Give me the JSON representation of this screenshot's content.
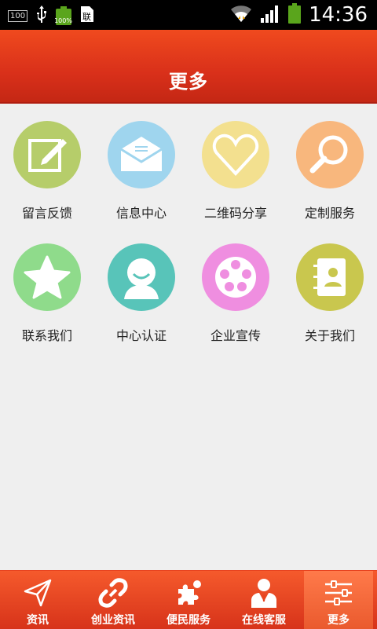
{
  "statusbar": {
    "box_label": "100",
    "battery_text": "100%",
    "time": "14:36"
  },
  "header": {
    "title": "更多"
  },
  "grid": [
    {
      "label": "留言反馈",
      "icon": "edit-note-icon",
      "color": "#b6cd6a"
    },
    {
      "label": "信息中心",
      "icon": "mail-icon",
      "color": "#9fd5ee"
    },
    {
      "label": "二维码分享",
      "icon": "heart-icon",
      "color": "#f3e08f"
    },
    {
      "label": "定制服务",
      "icon": "magnifier-icon",
      "color": "#f8b77d"
    },
    {
      "label": "联系我们",
      "icon": "star-icon",
      "color": "#8fdb8b"
    },
    {
      "label": "中心认证",
      "icon": "user-icon",
      "color": "#58c4b9"
    },
    {
      "label": "企业宣传",
      "icon": "film-reel-icon",
      "color": "#ef8ee0"
    },
    {
      "label": "关于我们",
      "icon": "contact-book-icon",
      "color": "#c9c74e"
    }
  ],
  "bottomnav": [
    {
      "label": "资讯",
      "icon": "paper-plane-icon"
    },
    {
      "label": "创业资讯",
      "icon": "link-icon"
    },
    {
      "label": "便民服务",
      "icon": "puzzle-icon"
    },
    {
      "label": "在线客服",
      "icon": "service-person-icon"
    },
    {
      "label": "更多",
      "icon": "sliders-icon",
      "active": true
    }
  ]
}
